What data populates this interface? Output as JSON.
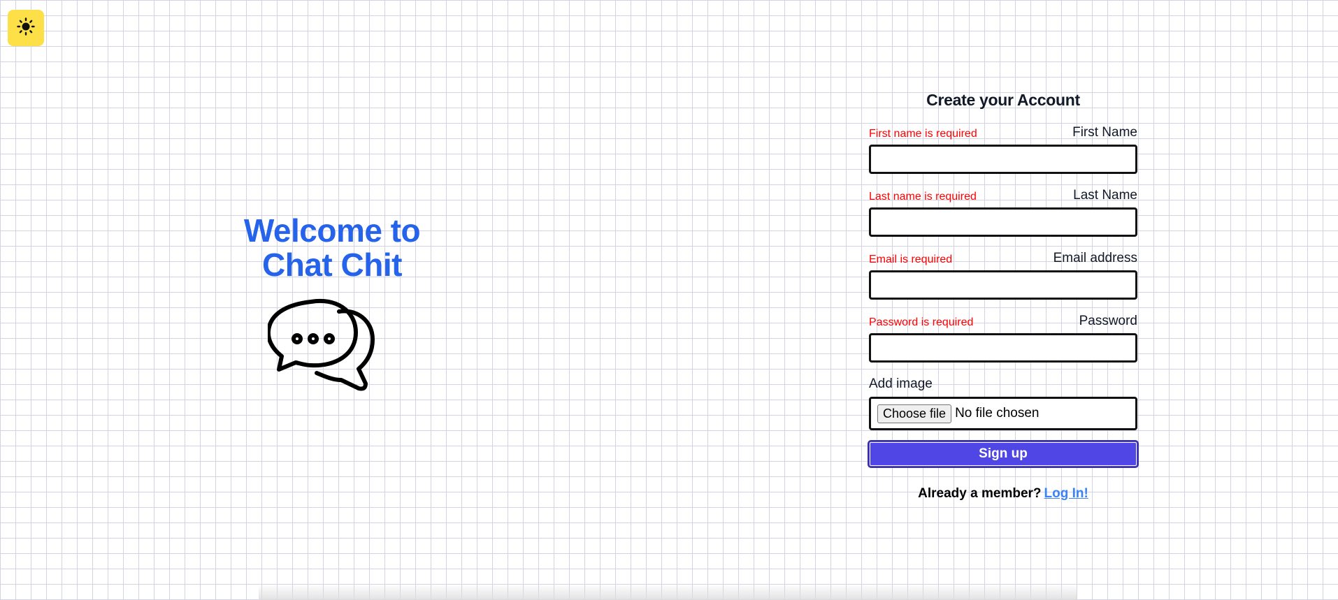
{
  "theme_toggle": {
    "icon": "sun-icon",
    "color": "#fde047"
  },
  "welcome": {
    "line1": "Welcome to",
    "line2": "Chat Chit",
    "color": "#2563eb",
    "logo_icon": "chat-bubbles-icon"
  },
  "form": {
    "title": "Create your Account",
    "fields": [
      {
        "error": "First name is required",
        "label": "First Name",
        "value": ""
      },
      {
        "error": "Last name is required",
        "label": "Last Name",
        "value": ""
      },
      {
        "error": "Email is required",
        "label": "Email address",
        "value": ""
      },
      {
        "error": "Password is required",
        "label": "Password",
        "value": ""
      }
    ],
    "image": {
      "label": "Add image",
      "button": "Choose file",
      "status": "No file chosen"
    },
    "submit": "Sign up",
    "submit_color": "#4f46e5",
    "member_text": "Already a member?",
    "login_link": "Log In!"
  }
}
